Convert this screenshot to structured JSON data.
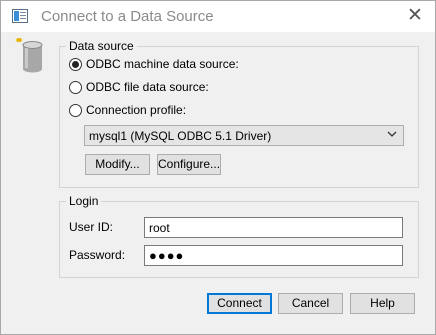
{
  "window": {
    "title": "Connect to a Data Source",
    "close_symbol": "✕"
  },
  "data_source": {
    "group_label": "Data source",
    "options": [
      {
        "label": "ODBC machine data source:",
        "selected": true
      },
      {
        "label": "ODBC file data source:",
        "selected": false
      },
      {
        "label": "Connection profile:",
        "selected": false
      }
    ],
    "profile_select": {
      "value": "mysql1 (MySQL ODBC 5.1 Driver)"
    },
    "modify_label": "Modify...",
    "configure_label": "Configure..."
  },
  "login": {
    "group_label": "Login",
    "user_id_label": "User ID:",
    "user_id_value": "root",
    "password_label": "Password:",
    "password_value": "●●●●"
  },
  "buttons": {
    "connect": "Connect",
    "cancel": "Cancel",
    "help": "Help"
  },
  "colors": {
    "dialog_bg": "#f0f0f0",
    "default_button_border": "#0078d7"
  },
  "icons": {
    "title": "data-source-window-icon",
    "database": "database-cylinder-icon",
    "close": "close-icon"
  }
}
